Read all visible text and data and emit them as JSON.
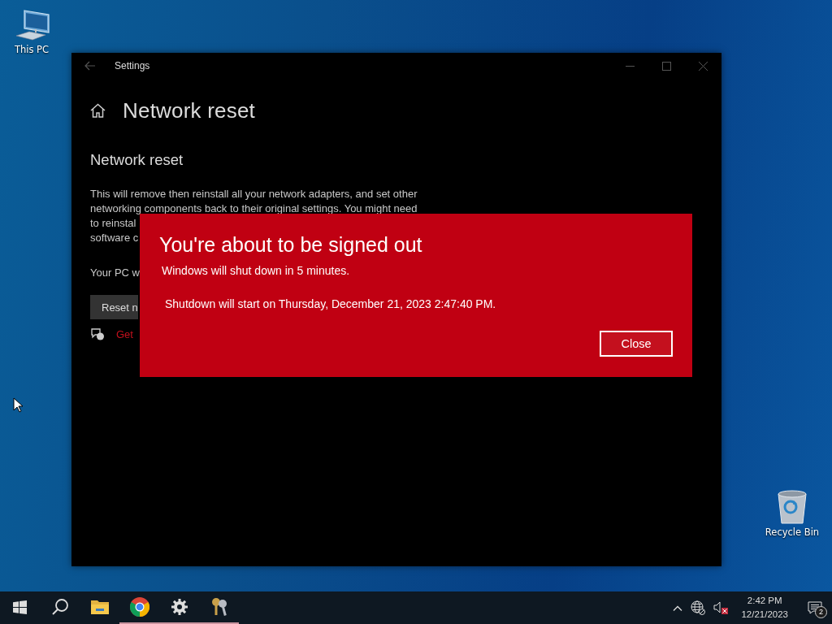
{
  "desktop_icons": [
    {
      "kind": "computer",
      "label": "This PC"
    },
    {
      "kind": "recycle",
      "label": "Recycle Bin"
    }
  ],
  "settings_window": {
    "title": "Settings",
    "heading": "Network reset",
    "section_title": "Network reset",
    "paragraph_lines": [
      "This will remove then reinstall all your network adapters, and set other",
      "networking components back to their original settings. You might need",
      "to reinstal",
      "software c"
    ],
    "note": "Your PC w",
    "button": "Reset n",
    "help_link": "Get"
  },
  "dialog": {
    "title": "You're about to be signed out",
    "message": "Windows will shut down in 5 minutes.",
    "detail": "Shutdown will start on Thursday, December 21, 2023 2:47:40 PM.",
    "button": "Close"
  },
  "taskbar": {
    "apps": [
      {
        "kind": "start",
        "running": false
      },
      {
        "kind": "search",
        "running": false
      },
      {
        "kind": "explorer",
        "running": false
      },
      {
        "kind": "chrome",
        "running": true
      },
      {
        "kind": "settings",
        "running": true
      },
      {
        "kind": "keys",
        "running": true
      }
    ],
    "time": "2:42 PM",
    "date": "12/21/2023",
    "notification_count": "2"
  }
}
